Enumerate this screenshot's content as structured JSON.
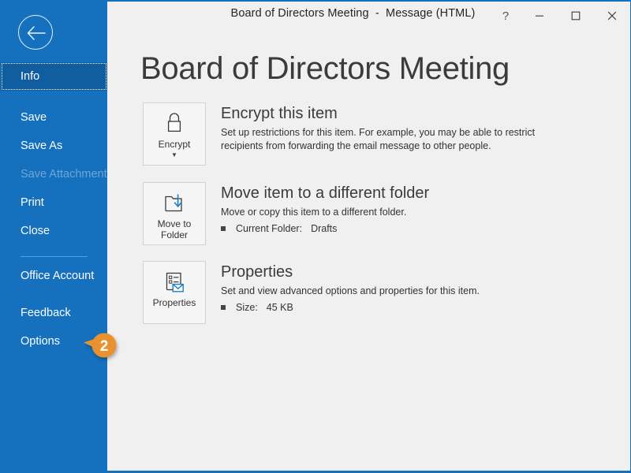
{
  "window": {
    "title": "Board of Directors Meeting  -  Message (HTML)",
    "help_label": "?",
    "minimize_label": "Minimize",
    "maximize_label": "Maximize",
    "close_label": "Close"
  },
  "sidebar": {
    "back_label": "Back",
    "accent_color": "#1570bd",
    "selected_color": "#105e9f",
    "items": [
      {
        "label": "Info",
        "state": "selected"
      },
      {
        "label": "Save",
        "state": "normal"
      },
      {
        "label": "Save As",
        "state": "normal"
      },
      {
        "label": "Save Attachments",
        "state": "disabled"
      },
      {
        "label": "Print",
        "state": "normal"
      },
      {
        "label": "Close",
        "state": "normal"
      },
      {
        "label": "Office Account",
        "state": "normal"
      },
      {
        "label": "Feedback",
        "state": "normal"
      },
      {
        "label": "Options",
        "state": "normal"
      }
    ]
  },
  "callout": {
    "number": "2",
    "color": "#e8912d"
  },
  "main": {
    "page_title": "Board of Directors Meeting",
    "sections": [
      {
        "id": "encrypt",
        "button_label": "Encrypt",
        "button_icon": "lock-icon",
        "has_caret": true,
        "heading": "Encrypt this item",
        "description": "Set up restrictions for this item. For example, you may be able to restrict recipients from forwarding the email message to other people.",
        "properties": []
      },
      {
        "id": "move-to-folder",
        "button_label": "Move to\nFolder",
        "button_icon": "move-to-folder-icon",
        "has_caret": false,
        "inline_caret": true,
        "heading": "Move item to a different folder",
        "description": "Move or copy this item to a different folder.",
        "properties": [
          {
            "label": "Current Folder:",
            "value": "Drafts"
          }
        ]
      },
      {
        "id": "properties",
        "button_label": "Properties",
        "button_icon": "properties-icon",
        "has_caret": false,
        "heading": "Properties",
        "description": "Set and view advanced options and properties for this item.",
        "properties": [
          {
            "label": "Size:",
            "value": "45 KB"
          }
        ]
      }
    ]
  }
}
